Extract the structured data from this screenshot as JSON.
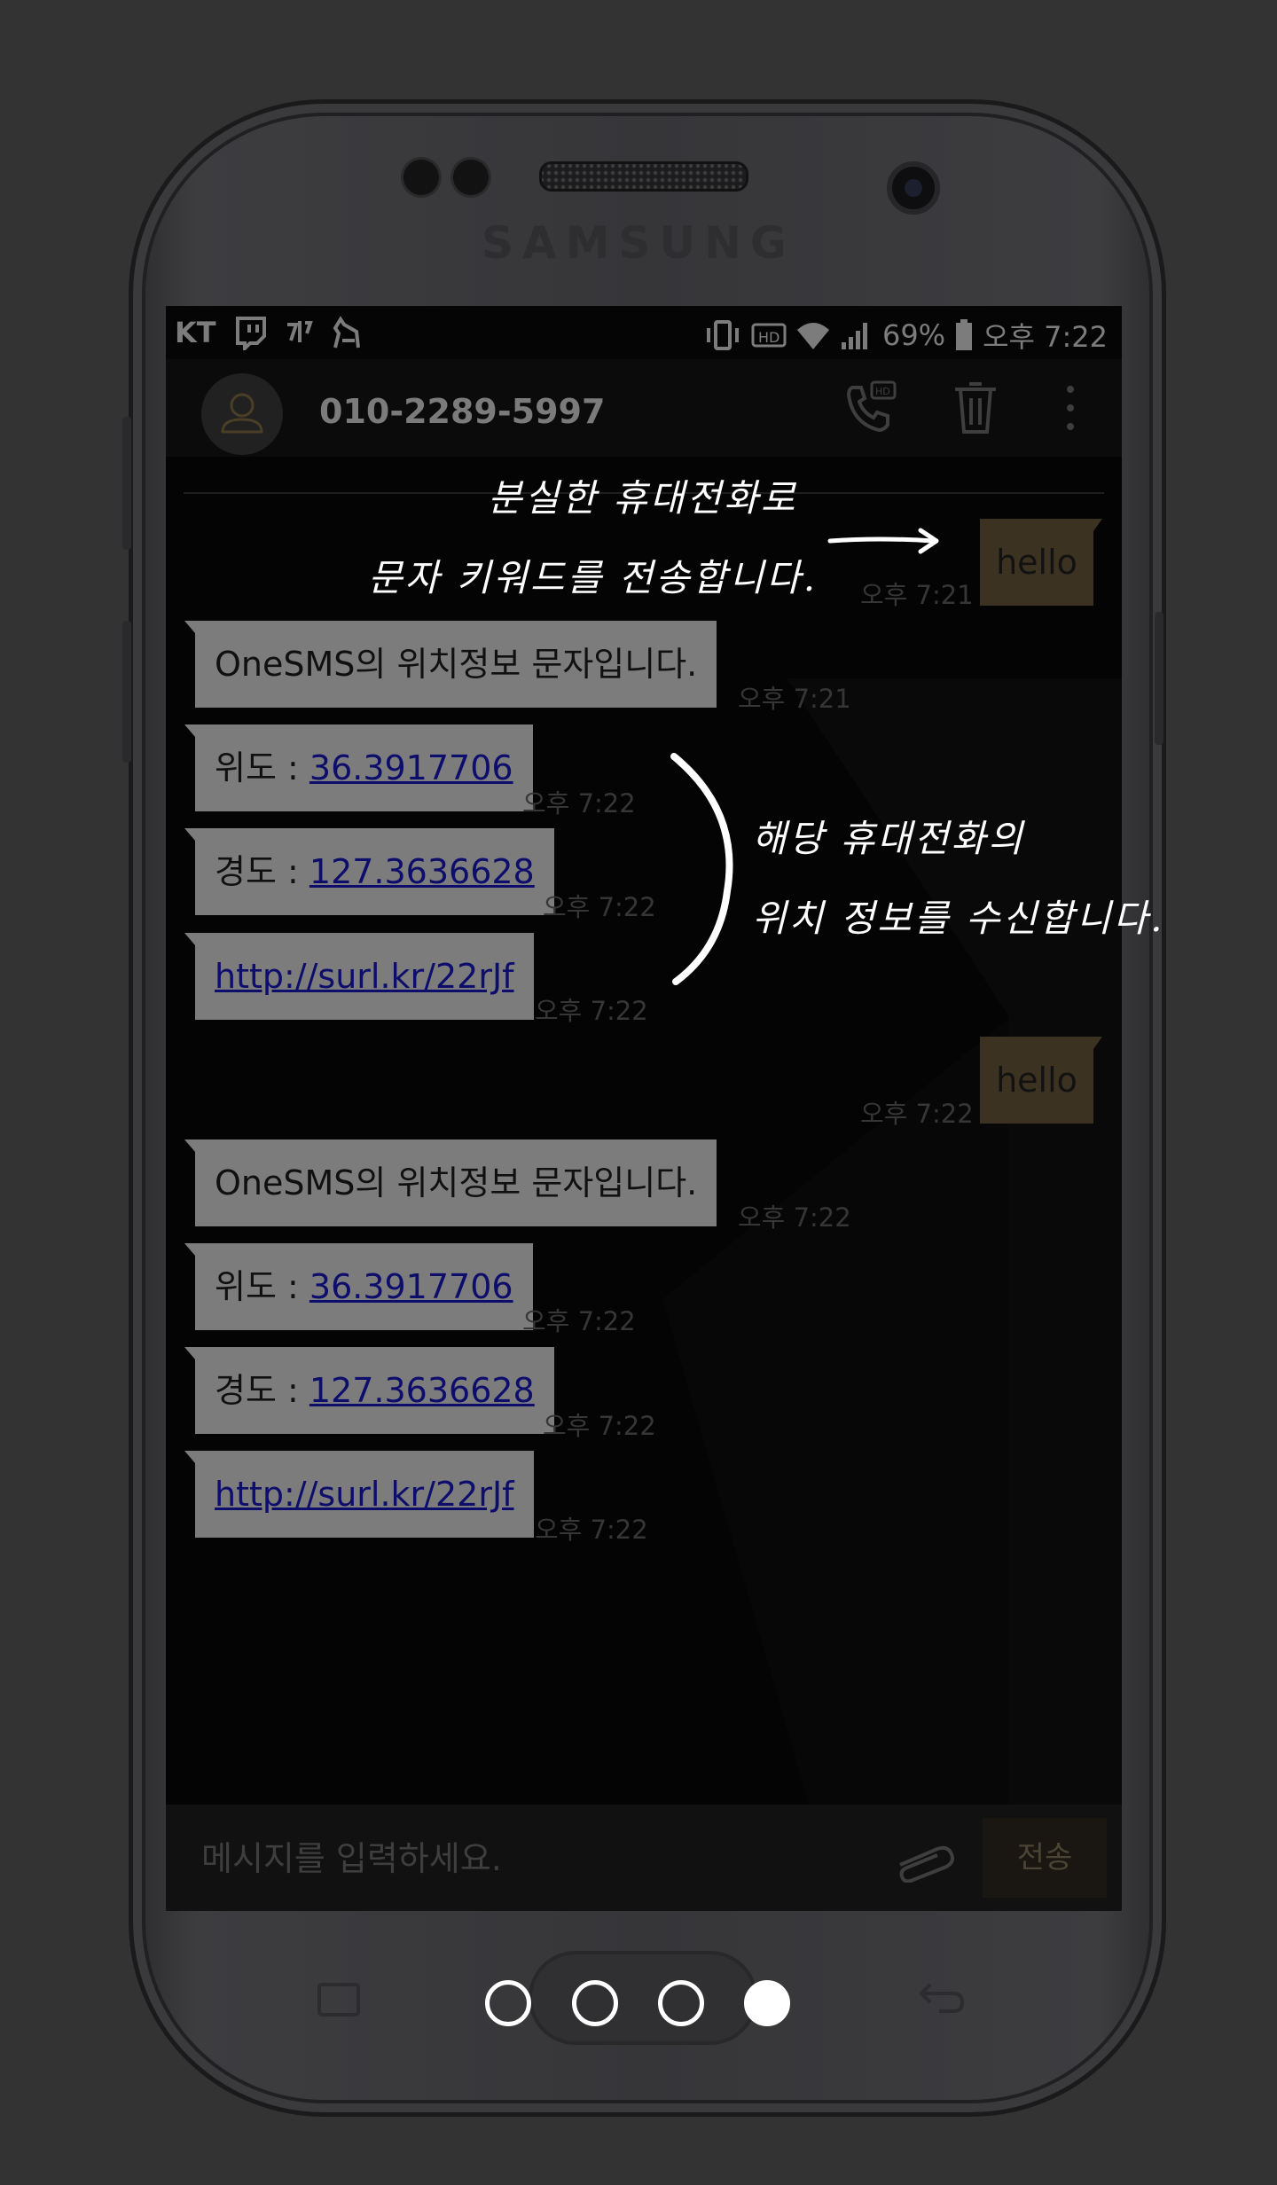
{
  "status_bar": {
    "carrier": "KT",
    "battery": "69%",
    "time": "오후 7:22"
  },
  "header": {
    "phone_number": "010-2289-5997"
  },
  "messages": {
    "m0": {
      "text": "hello",
      "time": "오후 7:21"
    },
    "m1": {
      "text": "OneSMS의 위치정보 문자입니다.",
      "time": "오후 7:21"
    },
    "m2": {
      "prefix": "위도 : ",
      "link": "36.3917706",
      "time": "오후 7:22"
    },
    "m3": {
      "prefix": "경도 : ",
      "link": "127.3636628",
      "time": "오후 7:22"
    },
    "m4": {
      "link": "http://surl.kr/22rJf",
      "time": "오후 7:22"
    },
    "m5": {
      "text": "hello",
      "time": "오후 7:22"
    },
    "m6": {
      "text": "OneSMS의 위치정보 문자입니다.",
      "time": "오후 7:22"
    },
    "m7": {
      "prefix": "위도 : ",
      "link": "36.3917706",
      "time": "오후 7:22"
    },
    "m8": {
      "prefix": "경도 : ",
      "link": "127.3636628",
      "time": "오후 7:22"
    },
    "m9": {
      "link": "http://surl.kr/22rJf",
      "time": "오후 7:22"
    }
  },
  "composer": {
    "placeholder": "메시지를 입력하세요.",
    "send_label": "전송"
  },
  "annotations": {
    "send_line1": "분실한 휴대전화로",
    "send_line2": "문자 키워드를 전송합니다.",
    "receive_line1": "해당 휴대전화의",
    "receive_line2": "위치 정보를 수신합니다."
  },
  "device": {
    "brand": "SAMSUNG"
  },
  "pager": {
    "total_pages": 4,
    "active_page": 4
  },
  "colors": {
    "background": "#333333",
    "incoming_bubble": "#7c7c7c",
    "outgoing_bubble": "#3c3222",
    "link": "#0d0d6b",
    "annotation": "#ffffff"
  }
}
